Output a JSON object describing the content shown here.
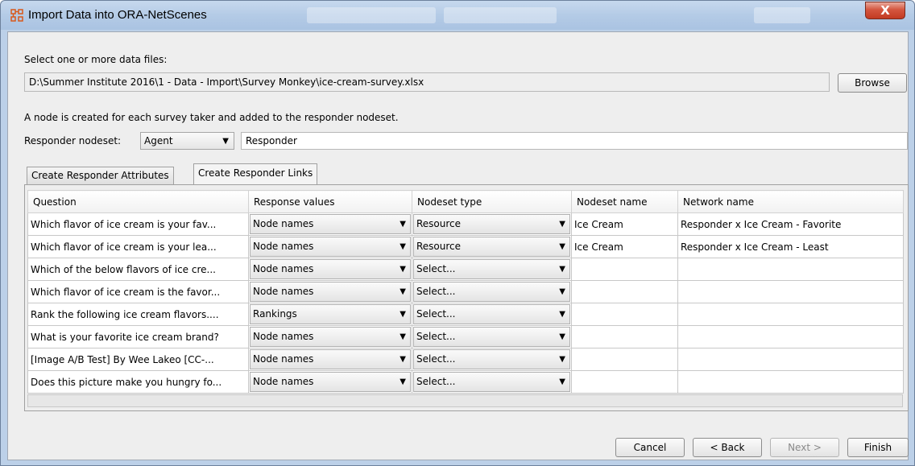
{
  "window": {
    "title": "Import Data into ORA-NetScenes",
    "close_glyph": "X",
    "app_icon": "ora-app-icon"
  },
  "files": {
    "label": "Select one or more data files:",
    "path": "D:\\Summer Institute 2016\\1 - Data - Import\\Survey Monkey\\ice-cream-survey.xlsx",
    "browse_label": "Browse"
  },
  "info_text": "A node is created for each survey taker and added to the responder nodeset.",
  "responder": {
    "label": "Responder nodeset:",
    "nodeset_type": "Agent",
    "nodeset_name": "Responder"
  },
  "tabs": [
    {
      "label": "Create Responder Attributes",
      "active": false
    },
    {
      "label": "Create Responder Links",
      "active": true
    }
  ],
  "table": {
    "columns": [
      "Question",
      "Response values",
      "Nodeset type",
      "Nodeset name",
      "Network name"
    ],
    "rows": [
      {
        "question": "Which flavor of ice cream is your fav...",
        "response": "Node names",
        "type": "Resource",
        "name": "Ice Cream",
        "network": "Responder x Ice Cream - Favorite"
      },
      {
        "question": "Which flavor of ice cream is your lea...",
        "response": "Node names",
        "type": "Resource",
        "name": "Ice Cream",
        "network": "Responder x Ice Cream - Least"
      },
      {
        "question": "Which of the below flavors of ice cre...",
        "response": "Node names",
        "type": "Select...",
        "name": "",
        "network": ""
      },
      {
        "question": "Which flavor of ice cream is the favor...",
        "response": "Node names",
        "type": "Select...",
        "name": "",
        "network": ""
      },
      {
        "question": "Rank the following ice cream flavors....",
        "response": "Rankings",
        "type": "Select...",
        "name": "",
        "network": ""
      },
      {
        "question": "What is your favorite ice cream brand?",
        "response": "Node names",
        "type": "Select...",
        "name": "",
        "network": ""
      },
      {
        "question": "[Image A/B Test] By Wee Lakeo [CC-...",
        "response": "Node names",
        "type": "Select...",
        "name": "",
        "network": ""
      },
      {
        "question": "Does this picture make you hungry fo...",
        "response": "Node names",
        "type": "Select...",
        "name": "",
        "network": ""
      }
    ]
  },
  "buttons": {
    "cancel": "Cancel",
    "back": "< Back",
    "next": "Next >",
    "finish": "Finish"
  },
  "colors": {
    "title_bar": "#b4cbe6",
    "close_button": "#c23a22",
    "dialog_bg": "#eeeeee"
  }
}
